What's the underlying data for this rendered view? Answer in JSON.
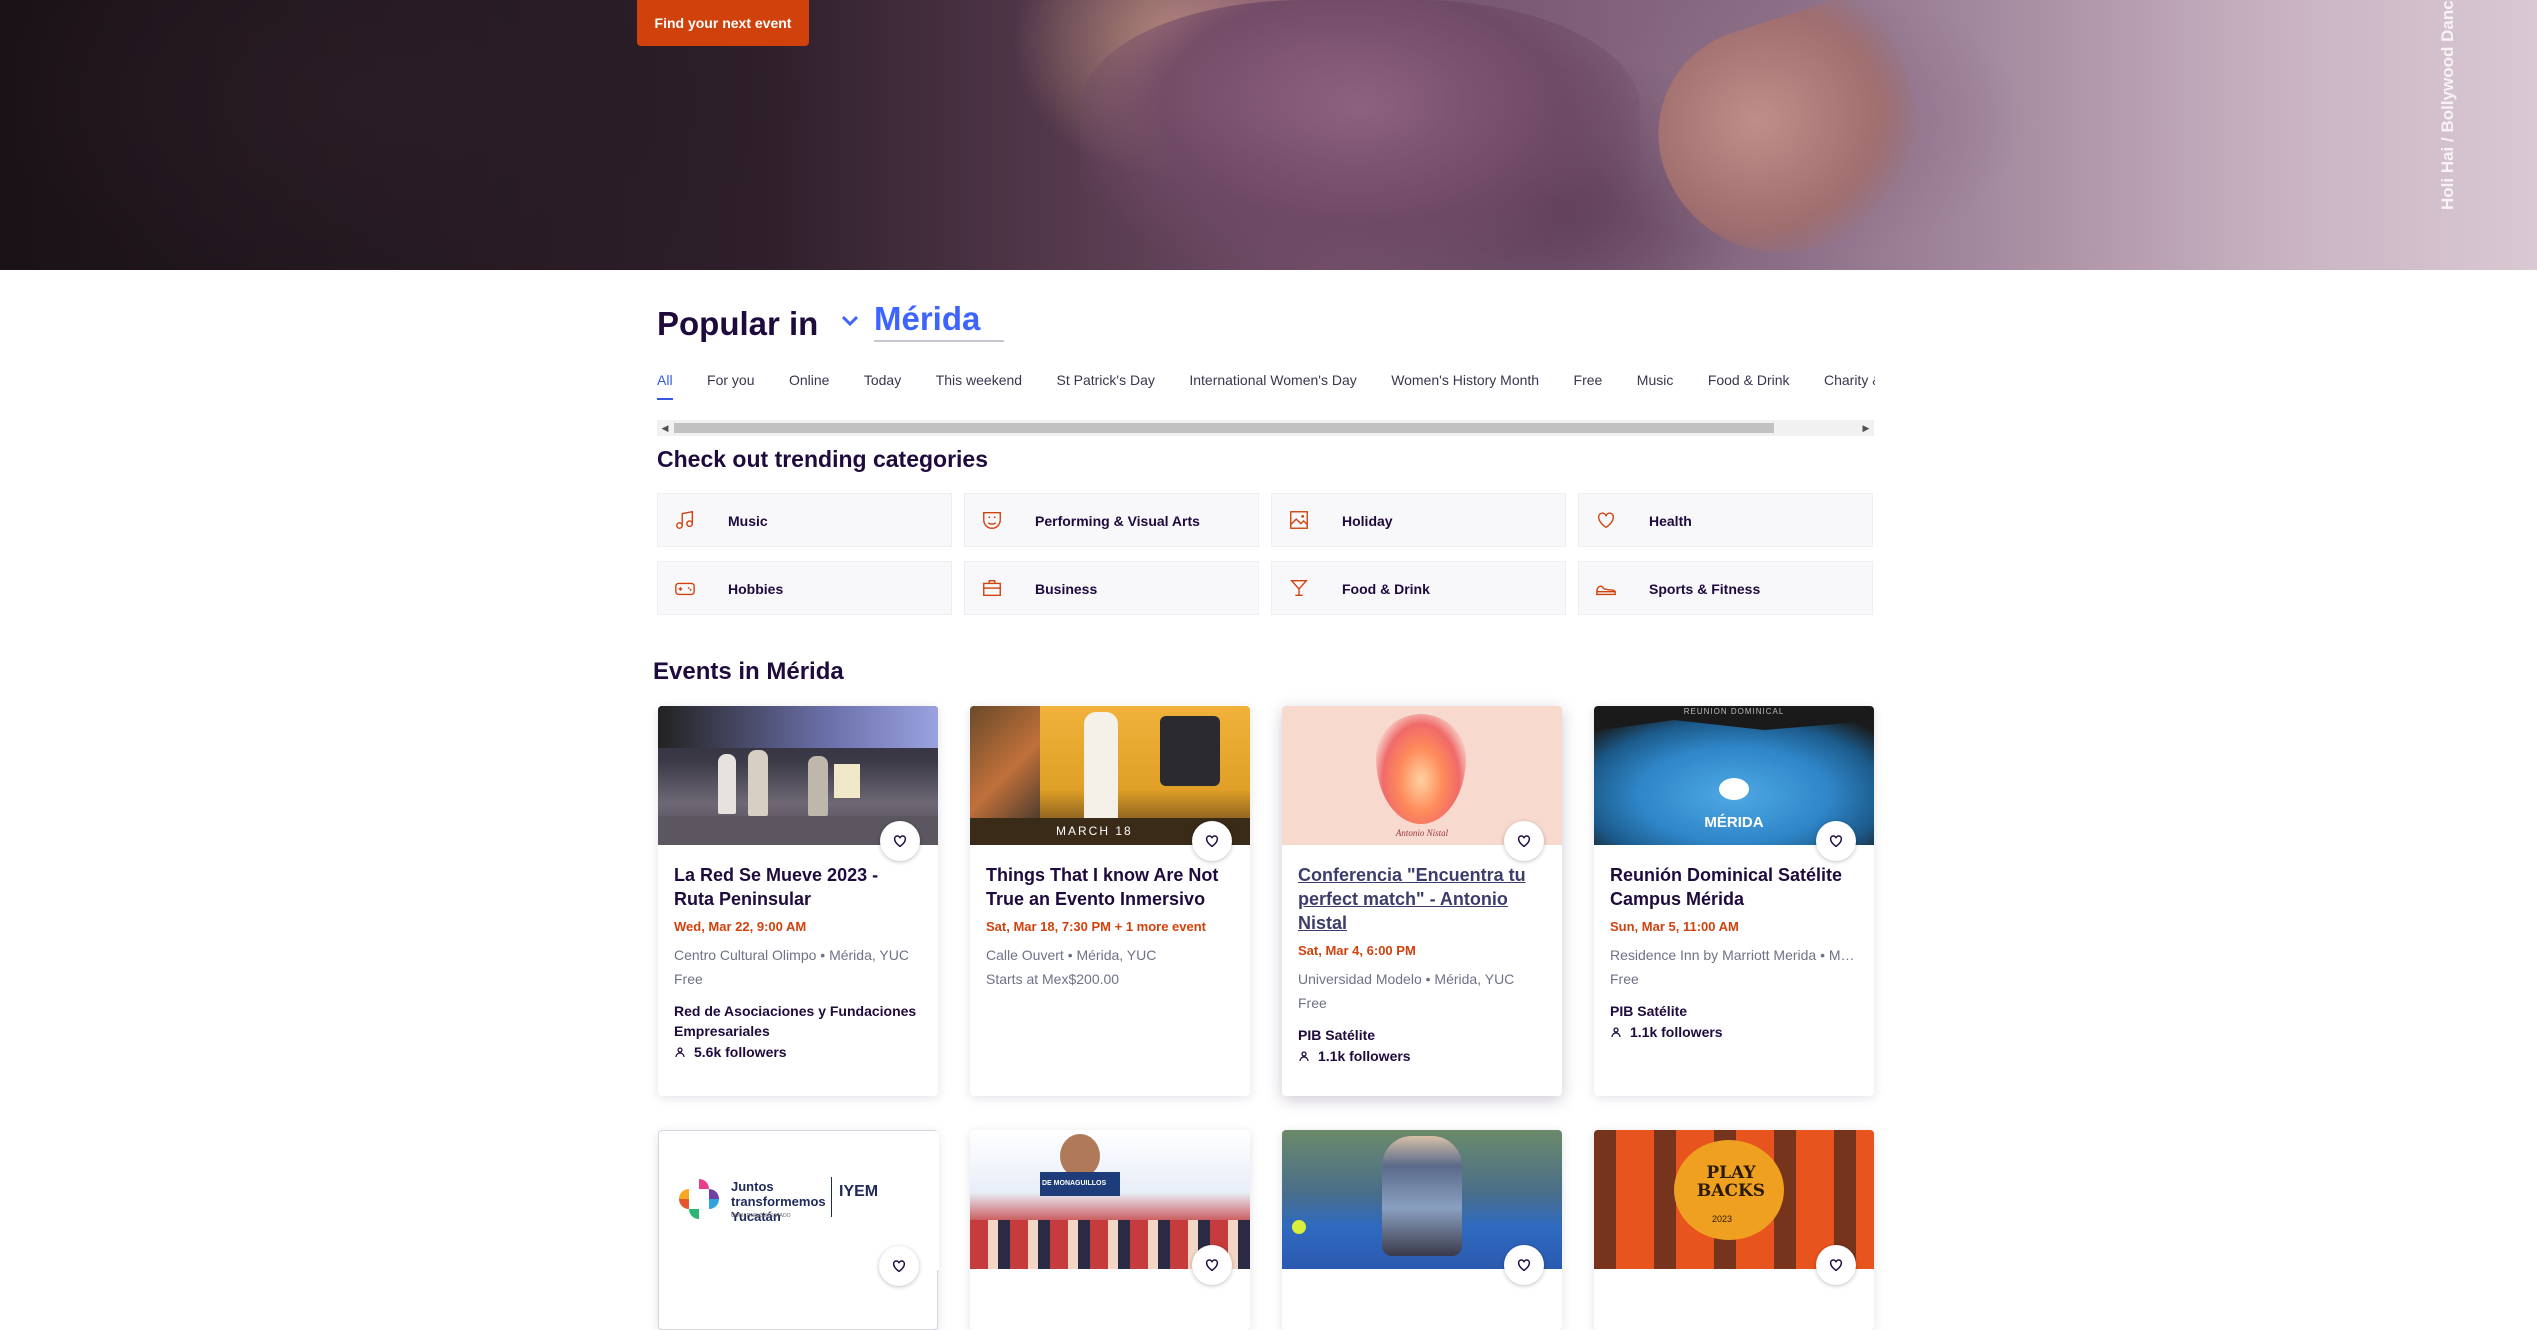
{
  "hero": {
    "cta_label": "Find your next event",
    "caption": "Holi Hai / Bollywood Dance Party"
  },
  "popular": {
    "title": "Popular in",
    "location": "Mérida",
    "tabs": [
      {
        "label": "All",
        "active": true
      },
      {
        "label": "For you"
      },
      {
        "label": "Online"
      },
      {
        "label": "Today"
      },
      {
        "label": "This weekend"
      },
      {
        "label": "St Patrick's Day"
      },
      {
        "label": "International Women's Day"
      },
      {
        "label": "Women's History Month"
      },
      {
        "label": "Free"
      },
      {
        "label": "Music"
      },
      {
        "label": "Food & Drink"
      },
      {
        "label": "Charity & Causes"
      }
    ]
  },
  "trending": {
    "title": "Check out trending categories",
    "categories": [
      {
        "label": "Music",
        "icon": "music-note-icon"
      },
      {
        "label": "Performing & Visual Arts",
        "icon": "theater-mask-icon"
      },
      {
        "label": "Holiday",
        "icon": "photo-frame-icon"
      },
      {
        "label": "Health",
        "icon": "heart-icon"
      },
      {
        "label": "Hobbies",
        "icon": "gamepad-icon"
      },
      {
        "label": "Business",
        "icon": "briefcase-icon"
      },
      {
        "label": "Food & Drink",
        "icon": "cocktail-icon"
      },
      {
        "label": "Sports & Fitness",
        "icon": "sneaker-icon"
      }
    ]
  },
  "events": {
    "title": "Events in Mérida",
    "cards": [
      {
        "title": "La Red Se Mueve 2023 - Ruta Peninsular",
        "date": "Wed, Mar 22, 9:00 AM",
        "venue": "Centro Cultural Olimpo • Mérida, YUC",
        "price": "Free",
        "organizer": "Red de Asociaciones y Fundaciones Empresariales",
        "followers": "5.6k followers"
      },
      {
        "title": "Things That I know Are Not True an Evento Inmersivo",
        "date": "Sat, Mar 18, 7:30 PM + 1 more event",
        "venue": "Calle Ouvert • Mérida, YUC",
        "price": "Starts at Mex$200.00",
        "image_text": "MARCH 18"
      },
      {
        "title": "Conferencia \"Encuentra tu perfect match\" - Antonio Nistal",
        "date": "Sat, Mar 4, 6:00 PM",
        "venue": "Universidad Modelo • Mérida, YUC",
        "price": "Free",
        "organizer": "PIB Satélite",
        "followers": "1.1k followers",
        "image_text": "Antonio Nistal"
      },
      {
        "title": "Reunión Dominical Satélite Campus Mérida",
        "date": "Sun, Mar 5, 11:00 AM",
        "venue": "Residence Inn by Marriott Merida • Mérida, YUC",
        "price": "Free",
        "organizer": "PIB Satélite",
        "followers": "1.1k followers",
        "image_text": "MÉRIDA",
        "image_banner": "REUNION DOMINICAL"
      }
    ],
    "row2": [
      {
        "image_text": "Juntos transformemos Yucatán",
        "image_sub": "IYEM",
        "image_sub2": "GOBIERNO DEL ESTADO"
      },
      {
        "image_text": "DE MONAGUILLOS"
      },
      {
        "image_text": ""
      },
      {
        "image_text": "PLAY BACKS",
        "image_sub": "2023"
      }
    ]
  },
  "colors": {
    "accent": "#d1410c",
    "link_blue": "#3d64ff",
    "text_dark": "#1e0a3c",
    "muted": "#6f7287"
  }
}
